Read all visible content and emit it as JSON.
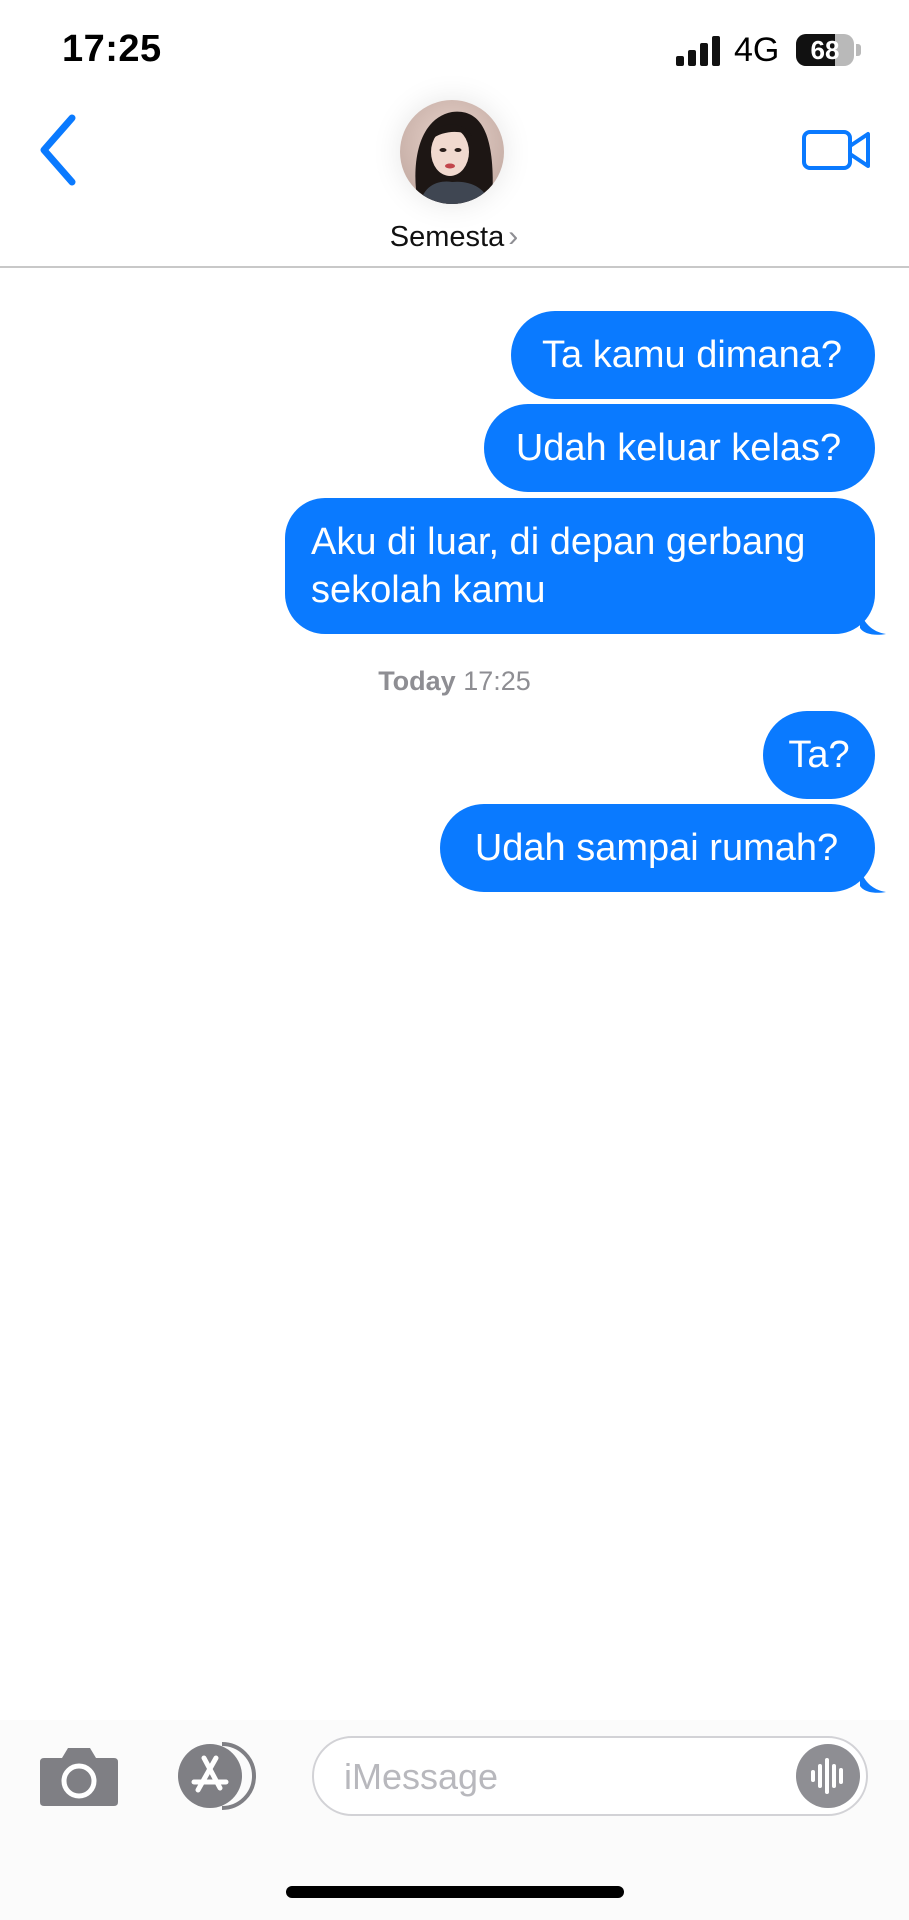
{
  "status_bar": {
    "time": "17:25",
    "network": "4G",
    "battery_level": "68",
    "battery_fraction": 0.68
  },
  "header": {
    "back_icon": "chevron-left-icon",
    "contact_name": "Semesta",
    "contact_chevron": "›",
    "video_icon": "video-camera-icon"
  },
  "conversation": {
    "messages_before": [
      "Ta kamu dimana?",
      "Udah keluar kelas?",
      "Aku di luar, di depan gerbang sekolah kamu"
    ],
    "timestamp_day": "Today",
    "timestamp_time": "17:25",
    "messages_after": [
      "Ta?",
      "Udah sampai rumah?"
    ]
  },
  "composer": {
    "placeholder": "iMessage",
    "camera_icon": "camera-icon",
    "apps_icon": "app-store-icon",
    "audio_icon": "waveform-icon"
  },
  "colors": {
    "accent": "#0a7aff",
    "bubble_text": "#ffffff",
    "secondary_text": "#8e8e93"
  }
}
